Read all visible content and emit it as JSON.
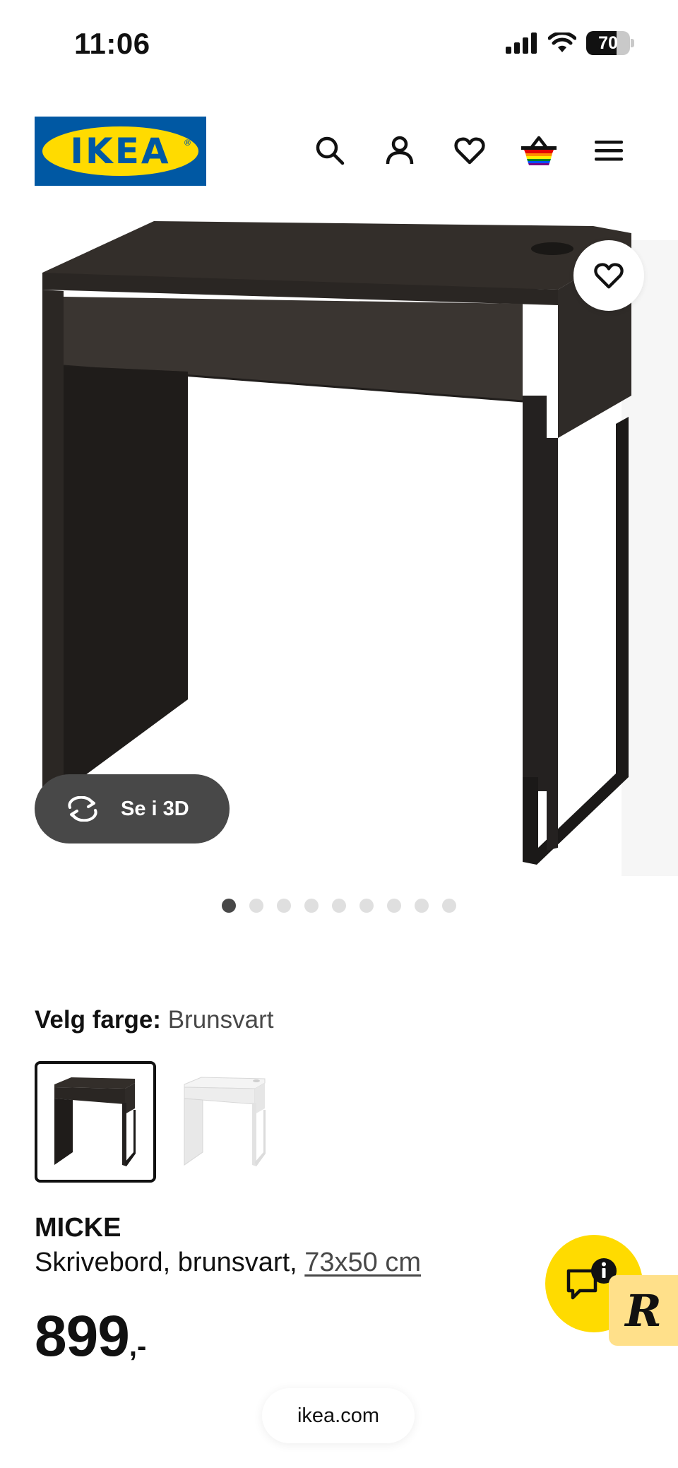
{
  "status_bar": {
    "time": "11:06",
    "battery_level": "70",
    "battery_fraction": 0.7
  },
  "header": {
    "logo_text": "IKEA",
    "logo_mark": "®",
    "icons": [
      "search-icon",
      "user-icon",
      "heart-icon",
      "basket-icon",
      "menu-icon"
    ]
  },
  "product_image": {
    "view_3d_label": "Se i 3D",
    "slide_count": 9,
    "active_slide": 1
  },
  "color_select": {
    "label": "Velg farge:",
    "value": "Brunsvart",
    "options": [
      "Brunsvart",
      "Hvit"
    ],
    "selected_index": 0
  },
  "product": {
    "name": "MICKE",
    "description": "Skrivebord, brunsvart,",
    "size": "73x50 cm",
    "price": "899",
    "price_suffix": ",-"
  },
  "chat": {
    "icon": "chat-info-icon",
    "badge_letter": "R"
  },
  "browser": {
    "url": "ikea.com"
  },
  "colors": {
    "ikea_blue": "#0058a3",
    "ikea_yellow": "#ffdb00",
    "dark_text": "#111111",
    "grey_button": "#484848"
  }
}
